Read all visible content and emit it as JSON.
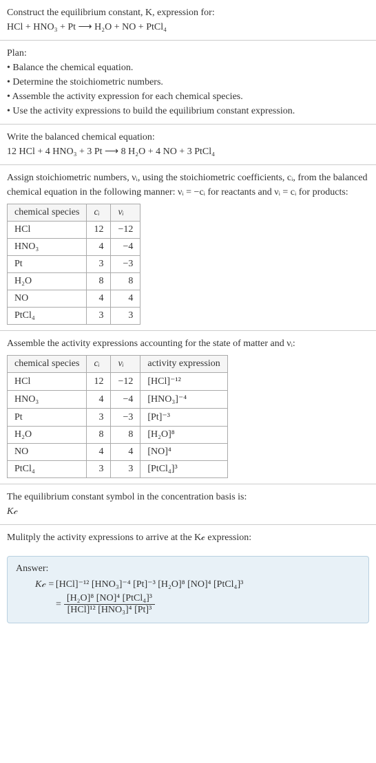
{
  "intro": {
    "line1": "Construct the equilibrium constant, K, expression for:",
    "equation": "HCl + HNO₃ + Pt ⟶ H₂O + NO + PtCl₄"
  },
  "plan": {
    "heading": "Plan:",
    "b1": "• Balance the chemical equation.",
    "b2": "• Determine the stoichiometric numbers.",
    "b3": "• Assemble the activity expression for each chemical species.",
    "b4": "• Use the activity expressions to build the equilibrium constant expression."
  },
  "balanced": {
    "heading": "Write the balanced chemical equation:",
    "equation": "12 HCl + 4 HNO₃ + 3 Pt ⟶ 8 H₂O + 4 NO + 3 PtCl₄"
  },
  "assign": {
    "text": "Assign stoichiometric numbers, νᵢ, using the stoichiometric coefficients, cᵢ, from the balanced chemical equation in the following manner: νᵢ = −cᵢ for reactants and νᵢ = cᵢ for products:",
    "headers": {
      "species": "chemical species",
      "c": "cᵢ",
      "v": "νᵢ"
    },
    "rows": [
      {
        "species": "HCl",
        "c": "12",
        "v": "−12"
      },
      {
        "species": "HNO₃",
        "c": "4",
        "v": "−4"
      },
      {
        "species": "Pt",
        "c": "3",
        "v": "−3"
      },
      {
        "species": "H₂O",
        "c": "8",
        "v": "8"
      },
      {
        "species": "NO",
        "c": "4",
        "v": "4"
      },
      {
        "species": "PtCl₄",
        "c": "3",
        "v": "3"
      }
    ]
  },
  "assemble": {
    "text": "Assemble the activity expressions accounting for the state of matter and νᵢ:",
    "headers": {
      "species": "chemical species",
      "c": "cᵢ",
      "v": "νᵢ",
      "act": "activity expression"
    },
    "rows": [
      {
        "species": "HCl",
        "c": "12",
        "v": "−12",
        "act": "[HCl]⁻¹²"
      },
      {
        "species": "HNO₃",
        "c": "4",
        "v": "−4",
        "act": "[HNO₃]⁻⁴"
      },
      {
        "species": "Pt",
        "c": "3",
        "v": "−3",
        "act": "[Pt]⁻³"
      },
      {
        "species": "H₂O",
        "c": "8",
        "v": "8",
        "act": "[H₂O]⁸"
      },
      {
        "species": "NO",
        "c": "4",
        "v": "4",
        "act": "[NO]⁴"
      },
      {
        "species": "PtCl₄",
        "c": "3",
        "v": "3",
        "act": "[PtCl₄]³"
      }
    ]
  },
  "symbol": {
    "line1": "The equilibrium constant symbol in the concentration basis is:",
    "kc": "K𝒸"
  },
  "multiply": {
    "text": "Mulitply the activity expressions to arrive at the K𝒸 expression:"
  },
  "answer": {
    "label": "Answer:",
    "lhs": "K𝒸 = ",
    "flat": "[HCl]⁻¹² [HNO₃]⁻⁴ [Pt]⁻³ [H₂O]⁸ [NO]⁴ [PtCl₄]³",
    "eq": "= ",
    "frac_num": "[H₂O]⁸ [NO]⁴ [PtCl₄]³",
    "frac_den": "[HCl]¹² [HNO₃]⁴ [Pt]³"
  },
  "chart_data": {
    "type": "table",
    "tables": [
      {
        "title": "Stoichiometric numbers",
        "columns": [
          "chemical species",
          "cᵢ",
          "νᵢ"
        ],
        "rows": [
          [
            "HCl",
            12,
            -12
          ],
          [
            "HNO₃",
            4,
            -4
          ],
          [
            "Pt",
            3,
            -3
          ],
          [
            "H₂O",
            8,
            8
          ],
          [
            "NO",
            4,
            4
          ],
          [
            "PtCl₄",
            3,
            3
          ]
        ]
      },
      {
        "title": "Activity expressions",
        "columns": [
          "chemical species",
          "cᵢ",
          "νᵢ",
          "activity expression"
        ],
        "rows": [
          [
            "HCl",
            12,
            -12,
            "[HCl]^-12"
          ],
          [
            "HNO₃",
            4,
            -4,
            "[HNO3]^-4"
          ],
          [
            "Pt",
            3,
            -3,
            "[Pt]^-3"
          ],
          [
            "H₂O",
            8,
            8,
            "[H2O]^8"
          ],
          [
            "NO",
            4,
            4,
            "[NO]^4"
          ],
          [
            "PtCl₄",
            3,
            3,
            "[PtCl4]^3"
          ]
        ]
      }
    ]
  }
}
